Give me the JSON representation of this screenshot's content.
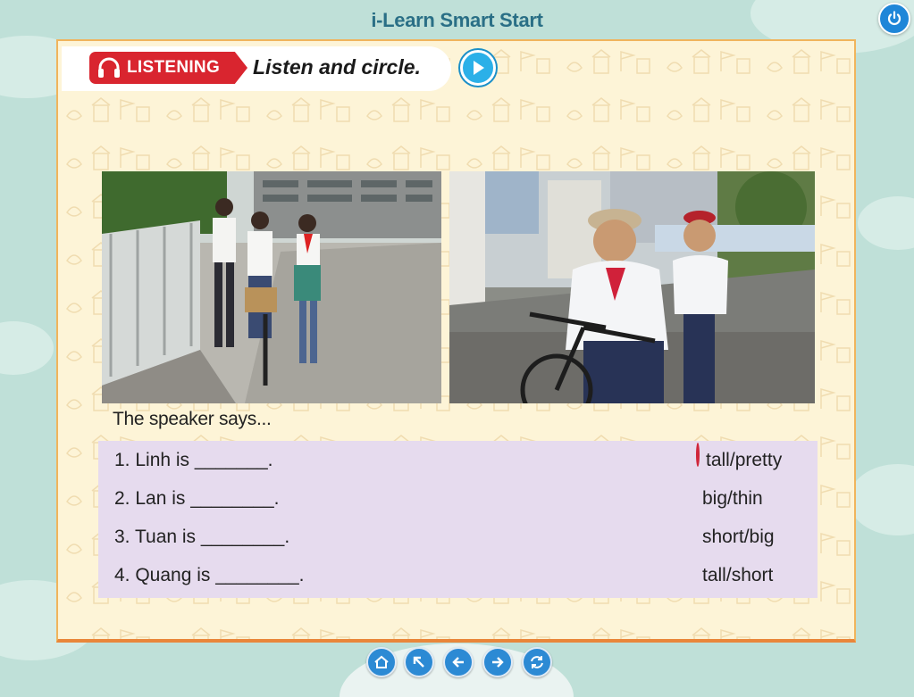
{
  "app": {
    "title": "i-Learn Smart Start"
  },
  "header": {
    "section_label": "LISTENING",
    "instruction": "Listen and circle."
  },
  "exercise": {
    "heading": "The speaker says...",
    "items": [
      {
        "question": "1. Linh is _______.",
        "option_a": "tall",
        "separator": "/",
        "option_b": "pretty",
        "circled": "tall"
      },
      {
        "question": "2. Lan is ________.",
        "option_a": "big",
        "separator": "/",
        "option_b": "thin",
        "circled": ""
      },
      {
        "question": "3. Tuan is ________.",
        "option_a": "short",
        "separator": "/",
        "option_b": "big",
        "circled": ""
      },
      {
        "question": "4. Quang is ________.",
        "option_a": "tall",
        "separator": "/",
        "option_b": "short",
        "circled": ""
      }
    ]
  },
  "icons": {
    "power": "power-icon",
    "play": "play-icon",
    "headphones": "headphones-icon",
    "nav": [
      "home-icon",
      "up-left-arrow-icon",
      "back-arrow-icon",
      "forward-arrow-icon",
      "refresh-icon"
    ]
  },
  "colors": {
    "accent_red": "#d9252f",
    "nav_blue": "#2c8ad4",
    "page_bg": "#fdf4d7",
    "exercise_bg": "#e6dbee"
  }
}
